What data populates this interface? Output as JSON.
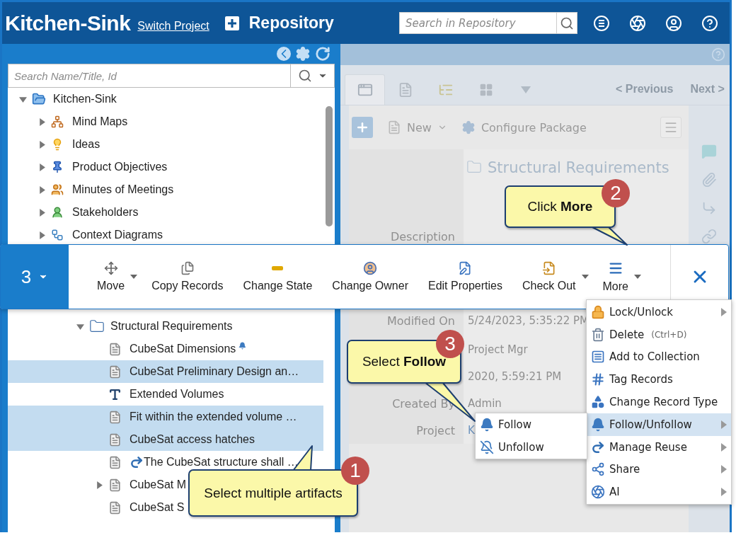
{
  "header": {
    "title": "Kitchen-Sink",
    "switch_link": "Switch Project",
    "section": "Repository",
    "search": {
      "placeholder": "Search in Repository"
    }
  },
  "left_panel": {
    "search": {
      "placeholder": "Search Name/Title, Id"
    },
    "tree": [
      {
        "label": "Kitchen-Sink",
        "kind": "folder-open",
        "expanded": true,
        "selected": false,
        "children": [
          {
            "label": "Mind Maps",
            "kind": "mindmap",
            "expanded": false,
            "selected": false
          },
          {
            "label": "Ideas",
            "kind": "idea",
            "expanded": false,
            "selected": false
          },
          {
            "label": "Product Objectives",
            "kind": "pin",
            "expanded": false,
            "selected": false
          },
          {
            "label": "Minutes of Meetings",
            "kind": "meeting",
            "expanded": false,
            "selected": false
          },
          {
            "label": "Stakeholders",
            "kind": "people",
            "expanded": false,
            "selected": false
          },
          {
            "label": "Context Diagrams",
            "kind": "diagram",
            "expanded": false,
            "selected": false
          }
        ]
      }
    ],
    "tree_continued": [
      {
        "label": "Structural Requirements",
        "kind": "folder",
        "expanded": true,
        "selected": false,
        "children": [
          {
            "label": "CubeSat Dimensions",
            "kind": "document",
            "selected": false,
            "followed": true,
            "reused": false
          },
          {
            "label": "CubeSat Preliminary Design an…",
            "kind": "document",
            "selected": true,
            "followed": false,
            "reused": false
          },
          {
            "label": "Extended Volumes",
            "kind": "text",
            "selected": false,
            "followed": false,
            "reused": false
          },
          {
            "label": "Fit within the extended volume …",
            "kind": "document",
            "selected": true,
            "followed": false,
            "reused": false
          },
          {
            "label": "CubeSat access hatches",
            "kind": "document",
            "selected": true,
            "followed": false,
            "reused": false
          },
          {
            "label": "The CubeSat structure shall …",
            "kind": "document",
            "selected": false,
            "followed": false,
            "reused": true
          },
          {
            "label": "CubeSat M",
            "kind": "document",
            "expanded": false,
            "selected": false,
            "followed": false,
            "reused": false
          },
          {
            "label": "CubeSat S",
            "kind": "document",
            "selected": false,
            "followed": false,
            "reused": false
          }
        ]
      }
    ]
  },
  "right_panel": {
    "tabs": [
      {
        "kind": "form",
        "selected": true
      },
      {
        "kind": "document",
        "selected": false
      },
      {
        "kind": "tree",
        "selected": false
      },
      {
        "kind": "grid",
        "selected": false
      }
    ],
    "previous": "< Previous",
    "next": "Next >",
    "new_button": "New",
    "configure_button": "Configure Package",
    "heading": "Structural Requirements",
    "details": [
      {
        "label": "Description"
      },
      {
        "label": "Modified On",
        "value": "5/24/2023, 5:35:22 PM"
      },
      {
        "value": "Project Mgr"
      },
      {
        "value": "2020, 5:59:21 PM"
      },
      {
        "label": "Created By",
        "value": "Admin"
      },
      {
        "label": "Project",
        "value": "K",
        "kind": "link"
      }
    ]
  },
  "selection_toolbar": {
    "count": "3",
    "actions": [
      {
        "label": "Move",
        "kind": "move",
        "has_menu": true
      },
      {
        "label": "Copy Records",
        "kind": "copy",
        "has_menu": false
      },
      {
        "label": "Change State",
        "kind": "state",
        "has_menu": false
      },
      {
        "label": "Change Owner",
        "kind": "owner",
        "has_menu": false
      },
      {
        "label": "Edit Properties",
        "kind": "edit",
        "has_menu": false
      },
      {
        "label": "Check Out",
        "kind": "checkout",
        "has_menu": true
      },
      {
        "label": "More",
        "kind": "more",
        "has_menu": true
      }
    ]
  },
  "more_menu": {
    "items": [
      {
        "label": "Lock/Unlock",
        "kind": "lock",
        "submenu": true,
        "selected": false
      },
      {
        "label": "Delete",
        "shortcut": "(Ctrl+D)",
        "kind": "trash",
        "submenu": false,
        "selected": false
      },
      {
        "label": "Add to Collection",
        "kind": "collection",
        "submenu": false,
        "selected": false
      },
      {
        "label": "Tag Records",
        "kind": "hash",
        "submenu": false,
        "selected": false
      },
      {
        "label": "Change Record Type",
        "kind": "shapes",
        "submenu": false,
        "selected": false
      },
      {
        "label": "Follow/Unfollow",
        "kind": "bell",
        "submenu": true,
        "selected": true
      },
      {
        "label": "Manage Reuse",
        "kind": "reuse",
        "submenu": true,
        "selected": false
      },
      {
        "label": "Share",
        "kind": "share",
        "submenu": true,
        "selected": false
      },
      {
        "label": "AI",
        "kind": "aperture",
        "submenu": true,
        "selected": false
      }
    ]
  },
  "follow_submenu": {
    "items": [
      {
        "label": "Follow",
        "kind": "bell"
      },
      {
        "label": "Unfollow",
        "kind": "bell-off"
      }
    ]
  },
  "callouts": [
    {
      "step": "1",
      "text": "Select multiple artifacts"
    },
    {
      "step": "2",
      "text": "Click **More**"
    },
    {
      "step": "3",
      "text": "Select **Follow**"
    }
  ]
}
